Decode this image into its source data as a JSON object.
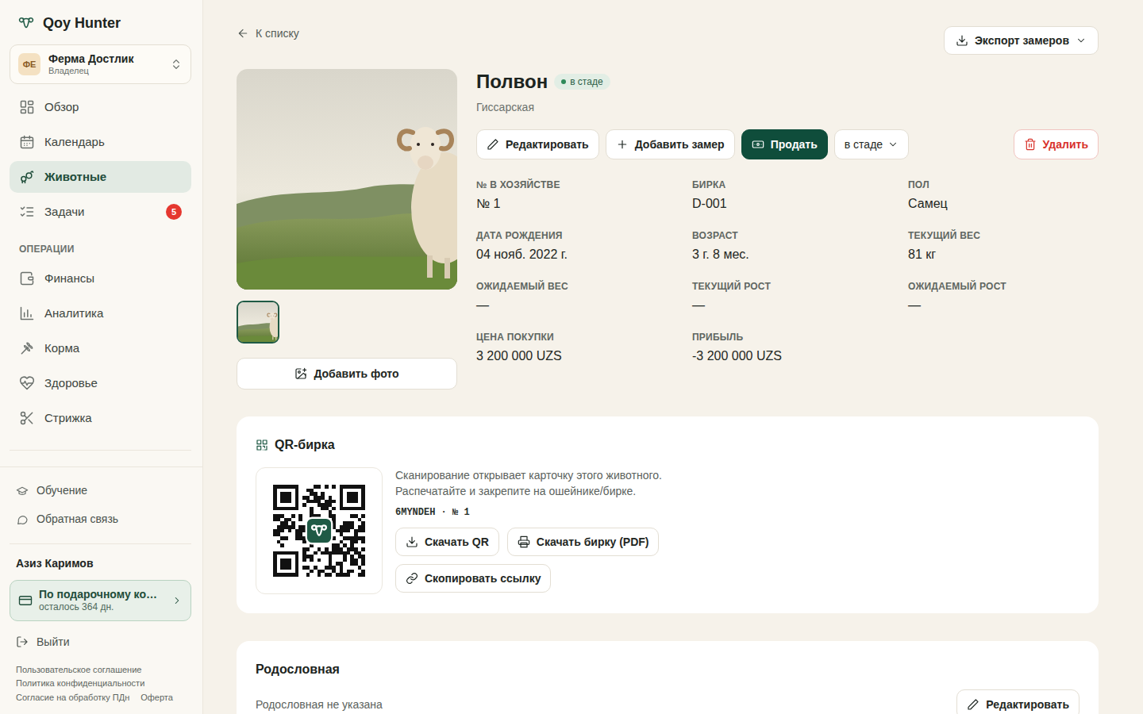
{
  "app": {
    "name": "Qoy Hunter"
  },
  "farm": {
    "initials": "ФЕ",
    "name": "Ферма Достлик",
    "role": "Владелец"
  },
  "nav": [
    {
      "label": "Обзор",
      "selected": false
    },
    {
      "label": "Календарь",
      "selected": false
    },
    {
      "label": "Животные",
      "selected": true
    },
    {
      "label": "Задачи",
      "selected": false,
      "badge": "5"
    }
  ],
  "operations": {
    "title": "ОПЕРАЦИИ",
    "items": [
      {
        "label": "Финансы",
        "selected": false
      },
      {
        "label": "Аналитика",
        "selected": false
      },
      {
        "label": "Корма",
        "selected": false
      },
      {
        "label": "Здоровье",
        "selected": false
      },
      {
        "label": "Стрижка",
        "selected": false
      }
    ]
  },
  "help": [
    {
      "label": "Обучение"
    },
    {
      "label": "Обратная связь"
    }
  ],
  "user": {
    "name": "Азиз Каримов"
  },
  "plan": {
    "title": "По подарочному ко…",
    "subtitle": "осталось 364 дн."
  },
  "logout": "Выйти",
  "legal": [
    "Пользовательское соглашение",
    "Политика конфиденциальности",
    "Согласие на обработку ПДн",
    "Оферта"
  ],
  "page": {
    "back": "К списку",
    "export": "Экспорт замеров"
  },
  "animal": {
    "name": "Полвон",
    "status": "в стаде",
    "breed": "Гиссарская"
  },
  "gallery": {
    "thumbnails": [
      {
        "selected": true
      }
    ],
    "add_photo": "Добавить фото"
  },
  "actions": {
    "edit": "Редактировать",
    "add_measure": "Добавить замер",
    "sell": "Продать",
    "status": "в стаде",
    "delete": "Удалить"
  },
  "fields": [
    {
      "label": "№ В ХОЗЯЙСТВЕ",
      "value": "№ 1"
    },
    {
      "label": "БИРКА",
      "value": "D-001"
    },
    {
      "label": "ПОЛ",
      "value": "Самец"
    },
    {
      "label": "ДАТА РОЖДЕНИЯ",
      "value": "04 нояб. 2022 г."
    },
    {
      "label": "ВОЗРАСТ",
      "value": "3 г. 8 мес."
    },
    {
      "label": "ТЕКУЩИЙ ВЕС",
      "value": "81 кг"
    },
    {
      "label": "ОЖИДАЕМЫЙ ВЕС",
      "value": "—"
    },
    {
      "label": "ТЕКУЩИЙ РОСТ",
      "value": "—"
    },
    {
      "label": "ОЖИДАЕМЫЙ РОСТ",
      "value": "—"
    },
    {
      "label": "ЦЕНА ПОКУПКИ",
      "value": "3 200 000 UZS"
    },
    {
      "label": "ПРИБЫЛЬ",
      "value": "-3 200 000 UZS"
    }
  ],
  "qr": {
    "title": "QR-бирка",
    "description": [
      "Сканирование открывает карточку этого животного.",
      "Распечатайте и закрепите на ошейнике/бирке."
    ],
    "code": "6MYNDEH · № 1",
    "buttons": [
      "Скачать QR",
      "Скачать бирку (PDF)",
      "Скопировать ссылку"
    ]
  },
  "pedigree": {
    "title": "Родословная",
    "empty": "Родословная не указана",
    "edit": "Редактировать"
  }
}
